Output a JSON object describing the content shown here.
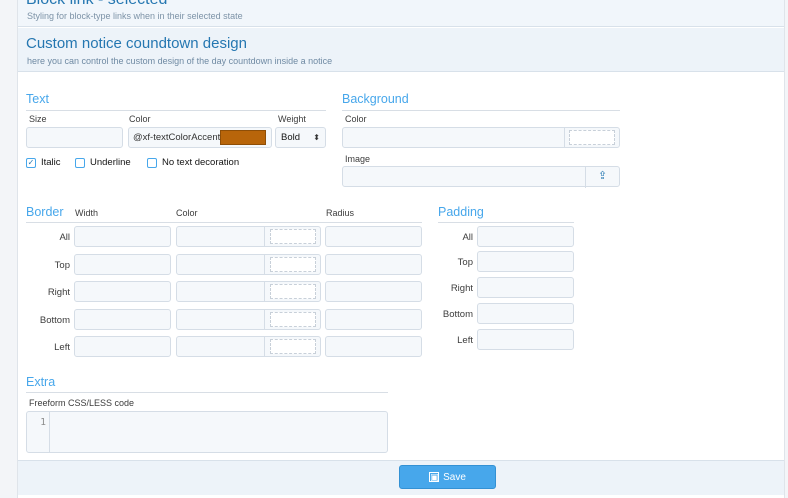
{
  "previous_section": {
    "title": "Block link - selected",
    "subtitle": "Styling for block-type links when in their selected state"
  },
  "section": {
    "title": "Custom notice coundtown design",
    "subtitle": "here you can control the custom design of the day countdown inside a notice"
  },
  "text_group": {
    "title": "Text",
    "size_label": "Size",
    "color_label": "Color",
    "weight_label": "Weight",
    "size_value": "",
    "color_value": "@xf-textColorAccent",
    "color_swatch": "#b8650a",
    "weight_value": "Bold",
    "weight_arrow": "⬍",
    "options": [
      {
        "label": "Italic",
        "checked": true,
        "mark": "✓"
      },
      {
        "label": "Underline",
        "checked": false,
        "mark": ""
      },
      {
        "label": "No text decoration",
        "checked": false,
        "mark": ""
      }
    ]
  },
  "background_group": {
    "title": "Background",
    "color_label": "Color",
    "image_label": "Image",
    "upload_icon": "⇪"
  },
  "border_group": {
    "title": "Border",
    "width_label": "Width",
    "color_label": "Color",
    "radius_label": "Radius",
    "rows": [
      "All",
      "Top",
      "Right",
      "Bottom",
      "Left"
    ]
  },
  "padding_group": {
    "title": "Padding",
    "rows": [
      "All",
      "Top",
      "Right",
      "Bottom",
      "Left"
    ]
  },
  "extra_group": {
    "title": "Extra",
    "code_label": "Freeform CSS/LESS code",
    "line_number": "1"
  },
  "footer": {
    "save_label": "Save",
    "save_icon": "▣"
  },
  "colors": {
    "accent": "#47a7eb",
    "title": "#2577b1",
    "swatch": "#b8650a"
  }
}
